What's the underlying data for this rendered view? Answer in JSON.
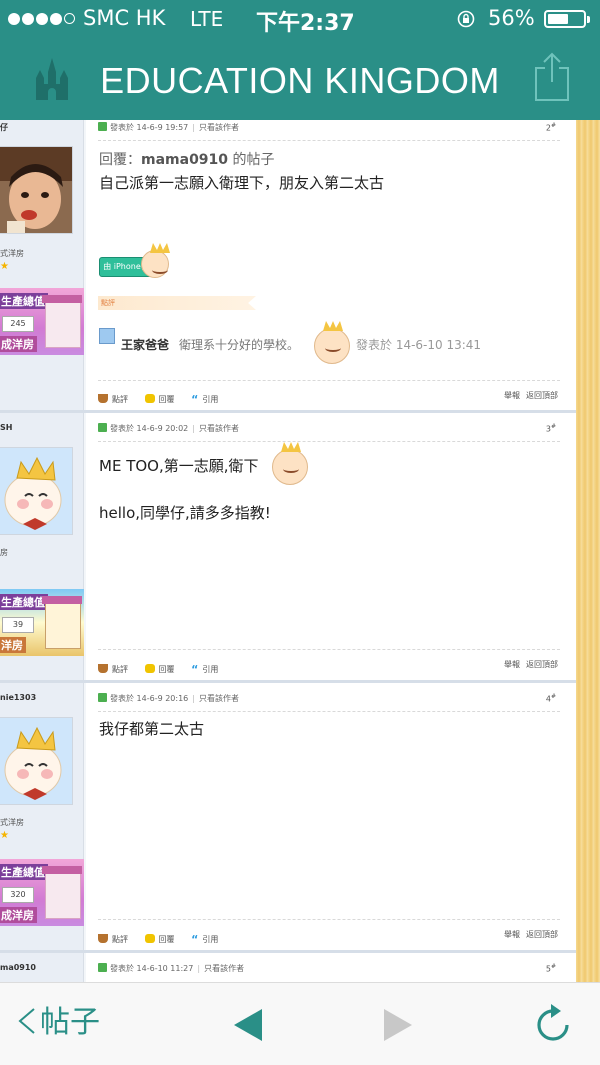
{
  "status_bar": {
    "carrier": "SMC HK",
    "network": "LTE",
    "time": "下午2:37",
    "battery": "56%",
    "battery_level": 0.56
  },
  "header": {
    "title": "EDUCATION KINGDOM",
    "left_icon": "castle-icon",
    "right_icon": "share-icon"
  },
  "posts": [
    {
      "username": "仔",
      "user_group": "式洋房",
      "medal": {
        "title": "生產總值",
        "value": "245",
        "label": "成洋房"
      },
      "meta": {
        "posted": "發表於 14-6-9 19:57",
        "only_author": "只看該作者"
      },
      "floor": "2",
      "quote": {
        "prefix": "回覆：",
        "user": "mama0910",
        "suffix": " 的帖子"
      },
      "lines": [
        "自己派第一志願入衛理下，朋友入第二太古"
      ],
      "device_badge": "由 iPhone發出",
      "rating": {
        "label": "點評",
        "user": "王家爸爸",
        "text": "衛理系十分好的學校。",
        "time": "發表於 14-6-10 13:41"
      },
      "actions": [
        "點評",
        "回覆",
        "引用"
      ],
      "report": [
        "舉報",
        "返回頂部"
      ]
    },
    {
      "username": "SH",
      "user_group": "房",
      "medal": {
        "title": "生產總值",
        "value": "39",
        "label": "洋房"
      },
      "meta": {
        "posted": "發表於 14-6-9 20:02",
        "only_author": "只看該作者"
      },
      "floor": "3",
      "lines": [
        "ME TOO,第一志願,衛下",
        "hello,同學仔,請多多指教!"
      ],
      "actions": [
        "點評",
        "回覆",
        "引用"
      ],
      "report": [
        "舉報",
        "返回頂部"
      ]
    },
    {
      "username": "nie1303",
      "user_group": "式洋房",
      "medal": {
        "title": "生產總值",
        "value": "320",
        "label": "成洋房"
      },
      "meta": {
        "posted": "發表於 14-6-9 20:16",
        "only_author": "只看該作者"
      },
      "floor": "4",
      "lines": [
        "我仔都第二太古"
      ],
      "actions": [
        "點評",
        "回覆",
        "引用"
      ],
      "report": [
        "舉報",
        "返回頂部"
      ]
    },
    {
      "username": "ma0910",
      "meta": {
        "posted": "發表於 14-6-10 11:27",
        "only_author": "只看該作者"
      },
      "floor": "5"
    }
  ],
  "toolbar": {
    "back_label": "帖子",
    "prev_icon": "prev-triangle-icon",
    "next_icon": "next-triangle-icon",
    "refresh_icon": "refresh-icon"
  },
  "colors": {
    "brand": "#2a8f87",
    "disabled": "#c8c8c8"
  }
}
